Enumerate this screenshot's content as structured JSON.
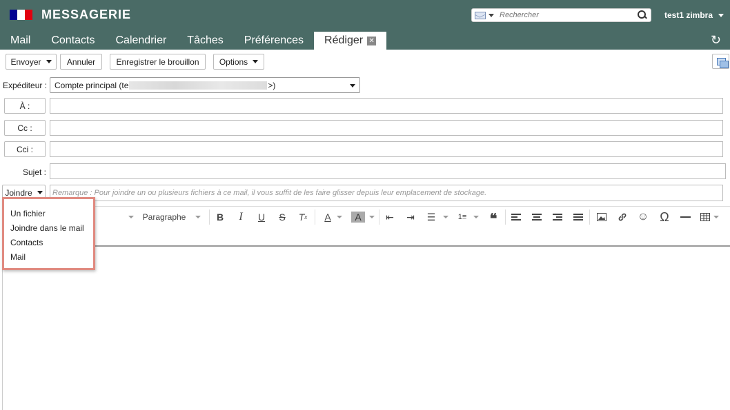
{
  "header": {
    "app_title": "MESSAGERIE",
    "search_placeholder": "Rechercher",
    "user_name": "test1 zimbra",
    "flag_colors": [
      "#000091",
      "#ffffff",
      "#e1000f"
    ],
    "bg_color": "#4a6b66"
  },
  "tabs": [
    {
      "label": "Mail"
    },
    {
      "label": "Contacts"
    },
    {
      "label": "Calendrier"
    },
    {
      "label": "Tâches"
    },
    {
      "label": "Préférences"
    },
    {
      "label": "Rédiger",
      "active": true,
      "close_icon": "close-icon"
    }
  ],
  "toolbar": {
    "send_label": "Envoyer",
    "cancel_label": "Annuler",
    "save_draft_label": "Enregistrer le brouillon",
    "options_label": "Options"
  },
  "form": {
    "sender_label": "Expéditeur :",
    "sender_value_prefix": "Compte principal (te",
    "sender_value_suffix": ">)",
    "to_label": "À :",
    "cc_label": "Cc :",
    "bcc_label": "Cci :",
    "subject_label": "Sujet :",
    "attach_label": "Joindre",
    "attach_note": "Remarque : Pour joindre un ou plusieurs fichiers à ce mail, il vous suffit de les faire glisser depuis leur emplacement de stockage."
  },
  "editor": {
    "paragraph_label": "Paragraphe",
    "icons": [
      "bold-icon",
      "italic-icon",
      "underline-icon",
      "strikethrough-icon",
      "clear-format-icon",
      "text-color-icon",
      "background-color-icon",
      "outdent-icon",
      "indent-icon",
      "bullet-list-icon",
      "numbered-list-icon",
      "blockquote-icon",
      "align-left-icon",
      "align-center-icon",
      "align-right-icon",
      "justify-icon",
      "image-icon",
      "link-icon",
      "emoji-icon",
      "special-char-icon",
      "horizontal-line-icon",
      "table-icon"
    ]
  },
  "attach_menu": {
    "items": [
      {
        "label": "Un fichier"
      },
      {
        "label": "Joindre dans le mail"
      },
      {
        "label": "Contacts"
      },
      {
        "label": "Mail"
      }
    ],
    "border_color": "#e08a80"
  }
}
